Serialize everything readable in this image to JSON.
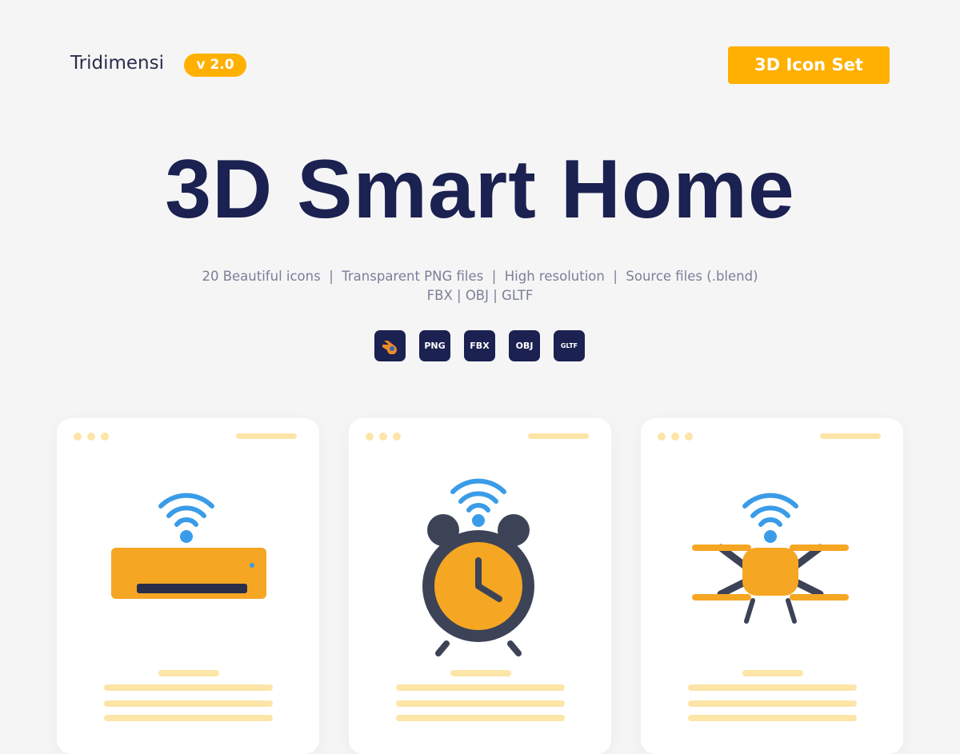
{
  "header": {
    "brand": "Tridimensi",
    "version": "v 2.0",
    "set_label": "3D Icon Set"
  },
  "hero": {
    "title": "3D Smart Home",
    "features_line1": "20 Beautiful icons  |  Transparent PNG files  |  High resolution  |  Source files (.blend)",
    "features_line2": "FBX | OBJ | GLTF"
  },
  "formats": [
    {
      "icon": "blender-icon",
      "label": ""
    },
    {
      "label": "PNG"
    },
    {
      "label": "FBX"
    },
    {
      "label": "OBJ"
    },
    {
      "icon": "gltf-icon",
      "label": "GLTF"
    }
  ],
  "cards": [
    {
      "icon": "smart-air-conditioner-icon"
    },
    {
      "icon": "smart-alarm-clock-icon"
    },
    {
      "icon": "smart-drone-icon"
    }
  ],
  "colors": {
    "accent": "#ffb000",
    "navy": "#1b2150",
    "wifi": "#3a9ce8",
    "placeholder": "#fde5a8"
  }
}
